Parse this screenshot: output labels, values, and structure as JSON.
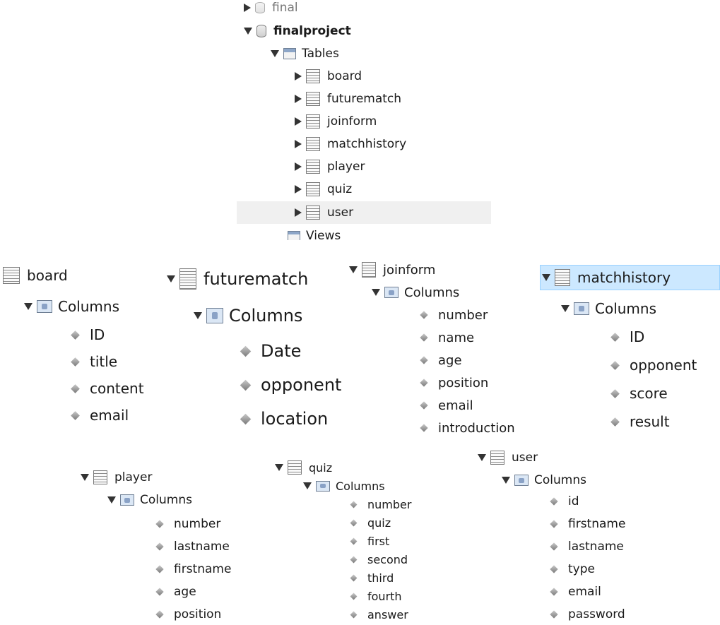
{
  "top_tree": {
    "partial_db": "final",
    "database": "finalproject",
    "tables_folder": "Tables",
    "tables": [
      "board",
      "futurematch",
      "joinform",
      "matchhistory",
      "player",
      "quiz",
      "user"
    ],
    "views_folder": "Views"
  },
  "columns_label": "Columns",
  "board": {
    "name": "board",
    "columns": [
      "ID",
      "title",
      "content",
      "email"
    ]
  },
  "futurematch": {
    "name": "futurematch",
    "columns": [
      "Date",
      "opponent",
      "location"
    ]
  },
  "joinform": {
    "name": "joinform",
    "columns": [
      "number",
      "name",
      "age",
      "position",
      "email",
      "introduction"
    ]
  },
  "matchhistory": {
    "name": "matchhistory",
    "columns": [
      "ID",
      "opponent",
      "score",
      "result"
    ]
  },
  "player": {
    "name": "player",
    "columns": [
      "number",
      "lastname",
      "firstname",
      "age",
      "position"
    ]
  },
  "quiz": {
    "name": "quiz",
    "columns": [
      "number",
      "quiz",
      "first",
      "second",
      "third",
      "fourth",
      "answer"
    ]
  },
  "user": {
    "name": "user",
    "columns": [
      "id",
      "firstname",
      "lastname",
      "type",
      "email",
      "password"
    ]
  },
  "colors": {
    "selected_row": "#f0f0f0",
    "highlight_row": "#cce8ff",
    "highlight_border": "#99d1ff"
  }
}
